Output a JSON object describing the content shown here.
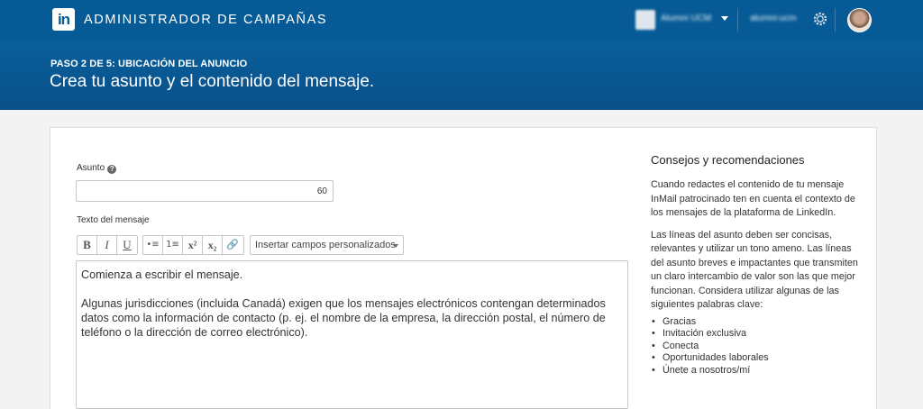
{
  "header": {
    "logo_text": "in",
    "app_title": "ADMINISTRADOR DE CAMPAÑAS",
    "account_name": "Alumni UCM",
    "account_id": "alumni-ucm"
  },
  "banner": {
    "step": "PASO 2 DE 5: UBICACIÓN DEL ANUNCIO",
    "headline": "Crea tu asunto y el contenido del mensaje."
  },
  "form": {
    "subject_label": "Asunto",
    "help_glyph": "?",
    "subject_value": "",
    "subject_counter": "60",
    "message_label": "Texto del mensaje",
    "toolbar": [
      "B",
      "I",
      "U",
      "•≡",
      "1≡",
      "x²",
      "x₂",
      "🔗"
    ],
    "toolbar_icons": [
      "bold-icon",
      "italic-icon",
      "underline-icon",
      "bulleted-list-icon",
      "numbered-list-icon",
      "superscript-icon",
      "subscript-icon",
      "link-icon"
    ],
    "personalize_label": "Insertar campos personalizados",
    "editor_line1": "Comienza a escribir el mensaje.",
    "editor_line2": "Algunas jurisdicciones (incluida Canadá) exigen que los mensajes electrónicos contengan determinados datos como la información de contacto (p. ej. el nombre de la empresa, la dirección postal, el número de teléfono o la dirección de correo electrónico)."
  },
  "tips": {
    "title": "Consejos y recomendaciones",
    "para1": "Cuando redactes el contenido de tu mensaje InMail patrocinado ten en cuenta el contexto de los mensajes de la plataforma de LinkedIn.",
    "para2": "Las líneas del asunto deben ser concisas, relevantes y utilizar un tono ameno. Las líneas del asunto breves e impactantes que transmiten un claro intercambio de valor son las que mejor funcionan. Considera utilizar algunas de las siguientes palabras clave:",
    "keywords": [
      "Gracias",
      "Invitación exclusiva",
      "Conecta",
      "Oportunidades laborales",
      "Únete a nosotros/mí"
    ]
  },
  "colors": {
    "brand": "#065a95",
    "banner": "#0a5089"
  }
}
